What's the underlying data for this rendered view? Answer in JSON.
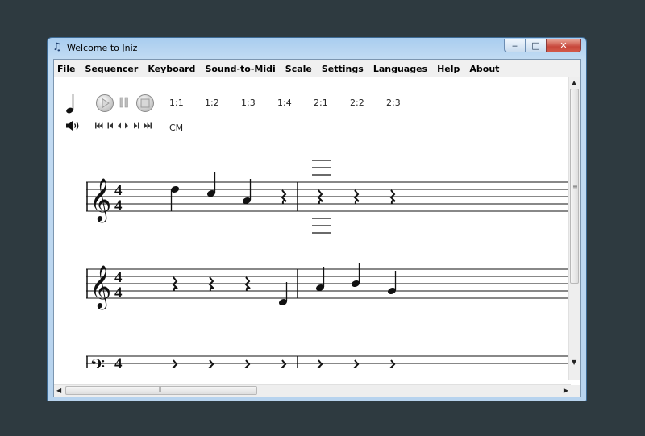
{
  "window": {
    "title": "Welcome to Jniz",
    "min_label": "‒",
    "max_label": "□",
    "close_label": "✕"
  },
  "menu": {
    "items": [
      "File",
      "Sequencer",
      "Keyboard",
      "Sound-to-Midi",
      "Scale",
      "Settings",
      "Languages",
      "Help",
      "About"
    ]
  },
  "toolbar": {
    "ratios": [
      "1:1",
      "1:2",
      "1:3",
      "1:4",
      "2:1",
      "2:2",
      "2:3"
    ],
    "key_label": "CM"
  },
  "score": {
    "time_signature": "4/4",
    "staves": [
      {
        "clef": "treble",
        "notes": [
          "quarter",
          "quarter",
          "quarter",
          "rest",
          "rest",
          "rest",
          "rest"
        ]
      },
      {
        "clef": "treble",
        "notes": [
          "rest",
          "rest",
          "rest",
          "quarter",
          "quarter",
          "quarter",
          "quarter"
        ]
      },
      {
        "clef": "bass",
        "notes": [
          "rest",
          "rest",
          "rest",
          "rest",
          "rest",
          "rest",
          "rest"
        ]
      }
    ]
  },
  "colors": {
    "desktop": "#2e3a40",
    "window_frame": "#b7d3ee",
    "close_button": "#c7463a"
  }
}
